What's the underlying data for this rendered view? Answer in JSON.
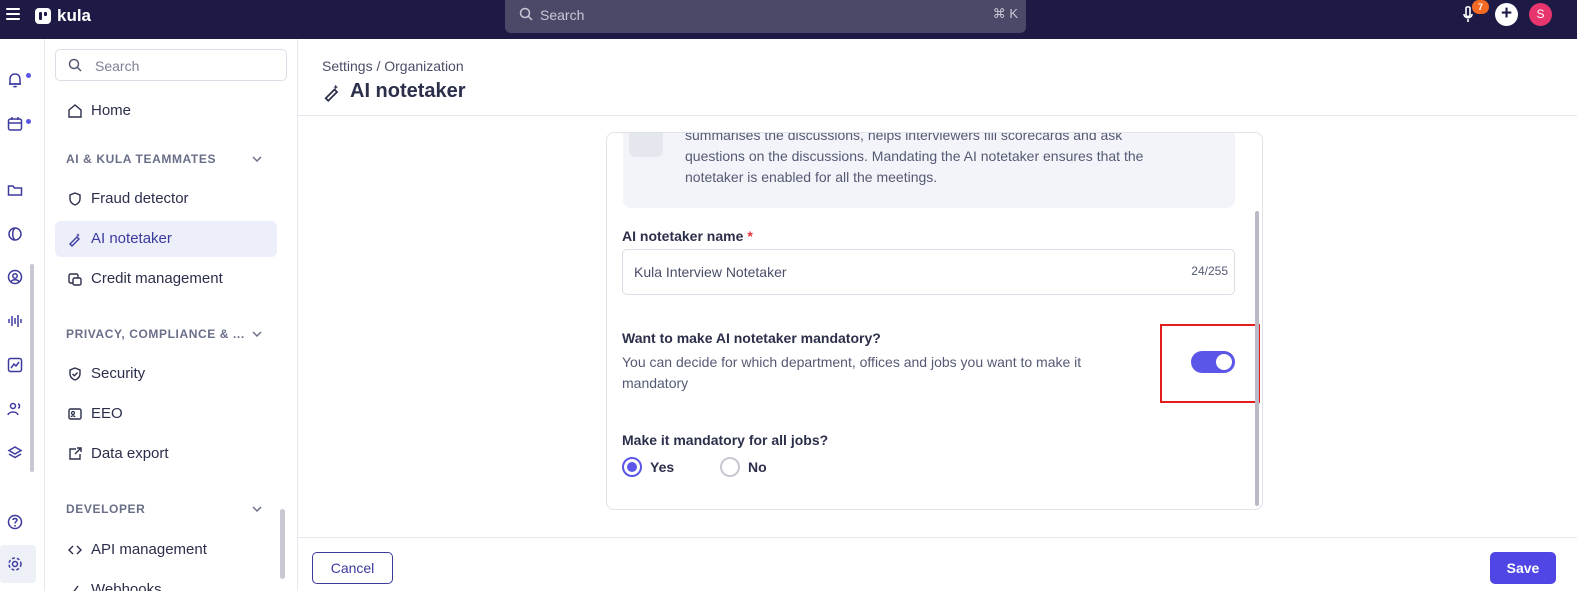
{
  "app": {
    "name": "kula"
  },
  "topbar": {
    "search_placeholder": "Search",
    "search_shortcut": "⌘ K",
    "notification_count": "7",
    "avatar_initial": "S"
  },
  "sidebar": {
    "search_placeholder": "Search",
    "home_label": "Home",
    "sections": [
      {
        "title": "AI & KULA TEAMMATES",
        "items": [
          "Fraud detector",
          "AI notetaker",
          "Credit management"
        ]
      },
      {
        "title": "PRIVACY, COMPLIANCE & ...",
        "items": [
          "Security",
          "EEO",
          "Data export"
        ]
      },
      {
        "title": "DEVELOPER",
        "items": [
          "API management",
          "Webhooks"
        ]
      }
    ],
    "active_item": "AI notetaker"
  },
  "header": {
    "breadcrumb": "Settings / Organization",
    "title": "AI notetaker"
  },
  "card": {
    "info_text_line1": "summarises the discussions, helps interviewers fill scorecards and ask",
    "info_text_line2": "questions on the discussions. Mandating the AI notetaker ensures that the",
    "info_text_line3": "notetaker is enabled for all the meetings.",
    "name_label": "AI notetaker name",
    "required_mark": "*",
    "name_value": "Kula Interview Notetaker",
    "name_counter": "24/255",
    "mandatory_question": "Want to make AI notetaker mandatory?",
    "mandatory_description": "You can decide for which department, offices and jobs you want to make it mandatory",
    "mandatory_enabled": true,
    "all_jobs_question": "Make it mandatory for all jobs?",
    "options": [
      "Yes",
      "No"
    ],
    "selected_option": "Yes"
  },
  "footer": {
    "cancel_label": "Cancel",
    "save_label": "Save"
  },
  "colors": {
    "topbar": "#1d1b45",
    "accent": "#5b56e8",
    "highlight": "#e31c1c",
    "notification_badge": "#f46a23",
    "avatar": "#e8356d"
  }
}
